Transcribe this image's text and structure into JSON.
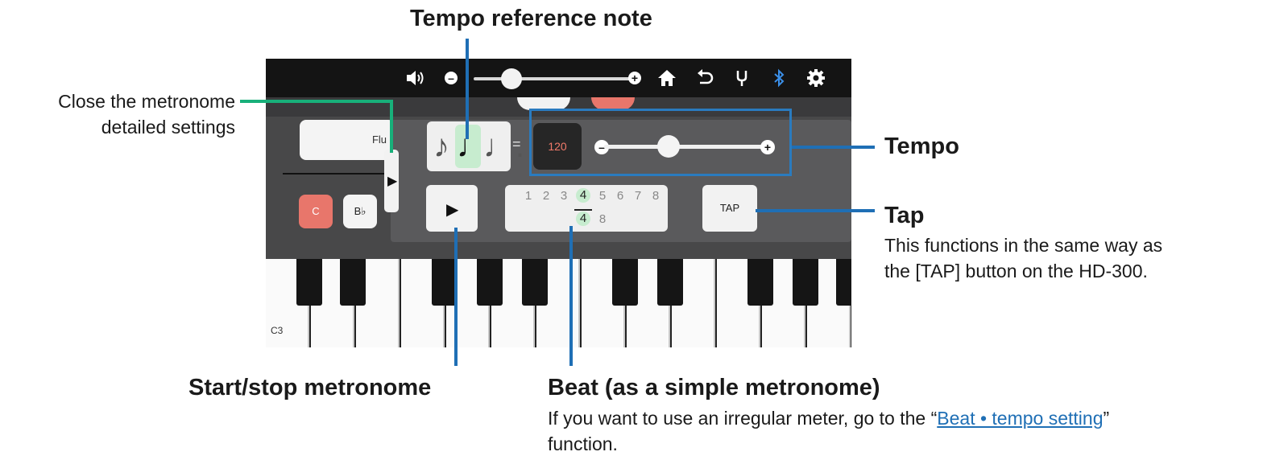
{
  "callouts": {
    "tempo_reference_note": "Tempo reference note",
    "close_line1": "Close the metronome",
    "close_line2": "detailed settings",
    "tempo": "Tempo",
    "tap": "Tap",
    "tap_desc_line1": "This functions in the same way as",
    "tap_desc_line2": "the [TAP] button on the HD-300.",
    "start_stop": "Start/stop metronome",
    "beat": "Beat (as a simple metronome)",
    "beat_desc_prefix": "If you want to use an irregular meter, go to the “",
    "beat_desc_link": "Beat • tempo setting",
    "beat_desc_suffix": "”",
    "beat_desc_line2": "function."
  },
  "app": {
    "instrument_label": "Flu",
    "key_c": "C",
    "key_bb": "B♭",
    "tempo_value": "120",
    "tap_label": "TAP",
    "beat_numerators": [
      "1",
      "2",
      "3",
      "4",
      "5",
      "6",
      "7",
      "8"
    ],
    "beat_denominators": [
      "4",
      "8"
    ],
    "selected_numerator": "4",
    "selected_denominator": "4",
    "octave_label": "C3",
    "note_values": [
      "♪",
      "♩",
      "♩."
    ],
    "selected_note_index": 1,
    "volume_level": 0.3,
    "tempo_slider_level": 0.4
  },
  "colors": {
    "callout_green": "#18b07a",
    "callout_blue": "#1f6fb5",
    "bluetooth": "#3b8fe8",
    "key_c_active": "#e8766b",
    "tempo_value_text": "#f17a6a",
    "selection_green": "#c7eccf"
  },
  "icons": [
    "speaker-icon",
    "minus-icon",
    "plus-icon",
    "home-icon",
    "undo-icon",
    "tuner-fork-icon",
    "bluetooth-icon",
    "gear-icon",
    "play-icon",
    "chevron-right-icon"
  ]
}
